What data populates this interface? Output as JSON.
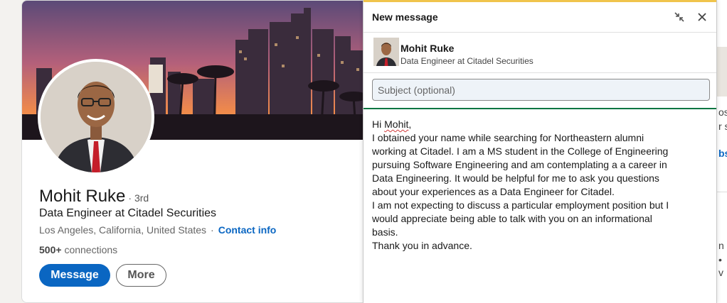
{
  "profile": {
    "name": "Mohit Ruke",
    "degree": "· 3rd",
    "headline": "Data Engineer at Citadel Securities",
    "location": "Los Angeles, California, United States",
    "location_separator": "·",
    "contact_info_label": "Contact info",
    "connections_count": "500+",
    "connections_label": "connections",
    "message_button": "Message",
    "more_button": "More"
  },
  "dialog": {
    "title": "New message",
    "recipient": {
      "name": "Mohit Ruke",
      "headline": "Data Engineer at Citadel Securities"
    },
    "subject": {
      "placeholder": "Subject (optional)",
      "value": ""
    },
    "message": {
      "greeting_word": "Hi",
      "greeting_name": "Mohit",
      "greeting_punct": ",",
      "lines": [
        "I obtained your name while searching for Northeastern alumni",
        "working at Citadel. I am a MS student in the College of Engineering",
        "pursuing Software Engineering and am contemplating a a career in",
        "Data Engineering. It would be helpful for me to ask you questions",
        "about your experiences as a Data Engineer for Citadel.",
        "I am not expecting to discuss a particular employment position but I",
        "would appreciate being able to talk with you on an informational",
        "basis.",
        "Thank you in advance."
      ]
    }
  },
  "background_fragments": {
    "frag1": "os",
    "frag2": "r s",
    "frag3": "bs",
    "frag4": "n •",
    "frag5": "•",
    "frag6": "v"
  },
  "colors": {
    "accent_blue": "#0a66c2",
    "focus_green": "#057642",
    "dialog_top_accent": "#f0c44c"
  },
  "icons": {
    "collapse": "collapse-icon",
    "close": "close-icon"
  }
}
